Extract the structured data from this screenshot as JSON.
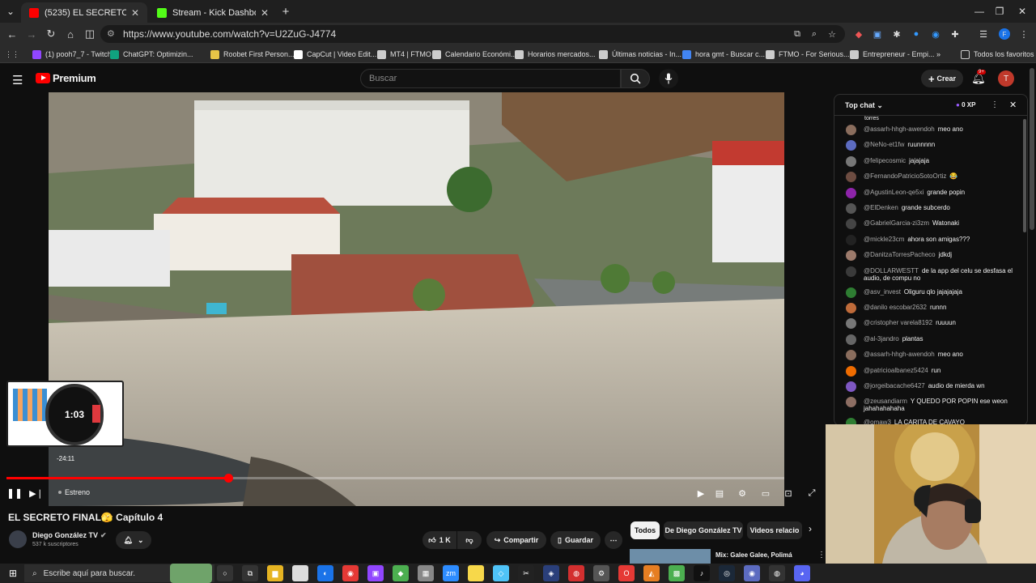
{
  "tabs": [
    {
      "label": "(5235) EL SECRETO FINAL🫣 Cap",
      "icon": "youtube-icon",
      "color": "#ff0000"
    },
    {
      "label": "Stream - Kick Dashboard",
      "icon": "kick-icon",
      "color": "#53fc18"
    }
  ],
  "address": {
    "url": "https://www.youtube.com/watch?v=U2ZuG-J4774"
  },
  "bookmarks": [
    {
      "label": "(1) pooh7_7 - Twitch",
      "color": "#9146ff"
    },
    {
      "label": "ChatGPT: Optimizin...",
      "color": "#10a37f"
    },
    {
      "label": "Roobet First Person...",
      "color": "#e8c547"
    },
    {
      "label": "CapCut | Video Edit...",
      "color": "#ffffff"
    },
    {
      "label": "MT4 | FTMO",
      "color": "#cccccc"
    },
    {
      "label": "Calendario Económi...",
      "color": "#cccccc"
    },
    {
      "label": "Horarios mercados...",
      "color": "#cccccc"
    },
    {
      "label": "Últimas noticias - In...",
      "color": "#cccccc"
    },
    {
      "label": "hora gmt - Buscar c...",
      "color": "#4285f4"
    },
    {
      "label": "FTMO - For Serious...",
      "color": "#cccccc"
    },
    {
      "label": "Entrepreneur - Empi...",
      "color": "#cccccc"
    }
  ],
  "bookmarks_all": "Todos los favoritos",
  "youtube": {
    "logo": "Premium",
    "search_placeholder": "Buscar",
    "create": "Crear",
    "notif_badge": "9+",
    "avatar_letter": "T"
  },
  "player": {
    "timer_preview": "1:03",
    "time_remaining": "-24:11",
    "premiere_label": "Estreno",
    "progress_fraction": 0.285
  },
  "video_info": {
    "title": "EL SECRETO FINAL🫣 Capítulo 4",
    "channel": "Diego González TV",
    "subscribers": "537 k suscriptores",
    "likes": "1 K",
    "share": "Compartir",
    "save": "Guardar"
  },
  "rec_tabs": [
    "Todos",
    "De Diego González TV",
    "Videos relacio"
  ],
  "rec_item": "Mix: Galee Galee, Polimá",
  "chat": {
    "header": "Top chat",
    "xp": "0 XP",
    "top_partial": "torres",
    "messages": [
      {
        "author": "@assarh-hhgh-awendoh",
        "text": "meo ano",
        "color": "#8a6d5d"
      },
      {
        "author": "@NeNo-et1fw",
        "text": "ruunnnnn",
        "color": "#5c6bc0"
      },
      {
        "author": "@felipecosmic",
        "text": "jajajaja",
        "color": "#777777"
      },
      {
        "author": "@FernandoPatricioSotoOrtiz",
        "text": "😂",
        "color": "#6d4c41"
      },
      {
        "author": "@AgustinLeon-qe5xi",
        "text": "grande popin",
        "color": "#8e24aa"
      },
      {
        "author": "@ElDenken",
        "text": "grande subcerdo",
        "color": "#555555"
      },
      {
        "author": "@GabrielGarcia-zi3zm",
        "text": "Watonaki",
        "color": "#444444"
      },
      {
        "author": "@mickle23cm",
        "text": "ahora son amigas???",
        "color": "#222222"
      },
      {
        "author": "@DanitzaTorresPacheco",
        "text": "jdkdj",
        "color": "#9c7a6b"
      },
      {
        "author": "@DOLLARWESTT",
        "text": "de la app del celu se desfasa el audio, de compu no",
        "color": "#3a3a3a"
      },
      {
        "author": "@asv_invest",
        "text": "Oliguru qlo jajajajaja",
        "color": "#2e7d32"
      },
      {
        "author": "@danilo escobar2632",
        "text": "runnn",
        "color": "#bf6b3a"
      },
      {
        "author": "@cristopher varela8192",
        "text": "ruuuun",
        "color": "#777777"
      },
      {
        "author": "@al-3jandro",
        "text": "plantas",
        "color": "#666666"
      },
      {
        "author": "@assarh-hhgh-awendoh",
        "text": "meo ano",
        "color": "#8a6d5d"
      },
      {
        "author": "@patricioalbanez5424",
        "text": "run",
        "color": "#ef6c00"
      },
      {
        "author": "@jorgeibacache6427",
        "text": "audio de mierda wn",
        "color": "#7e57c2"
      },
      {
        "author": "@zeusandiarm",
        "text": "Y QUEDO POR POPIN ese weon jahahahahaha",
        "color": "#8d6e63"
      },
      {
        "author": "@omaw3",
        "text": "LA CARITA DE CAVAYO",
        "color": "#2e7d32"
      }
    ]
  },
  "taskbar": {
    "search_placeholder": "Escribe aquí para buscar."
  },
  "colors": {
    "accent": "#ff0000",
    "bg": "#0f0f0f"
  }
}
